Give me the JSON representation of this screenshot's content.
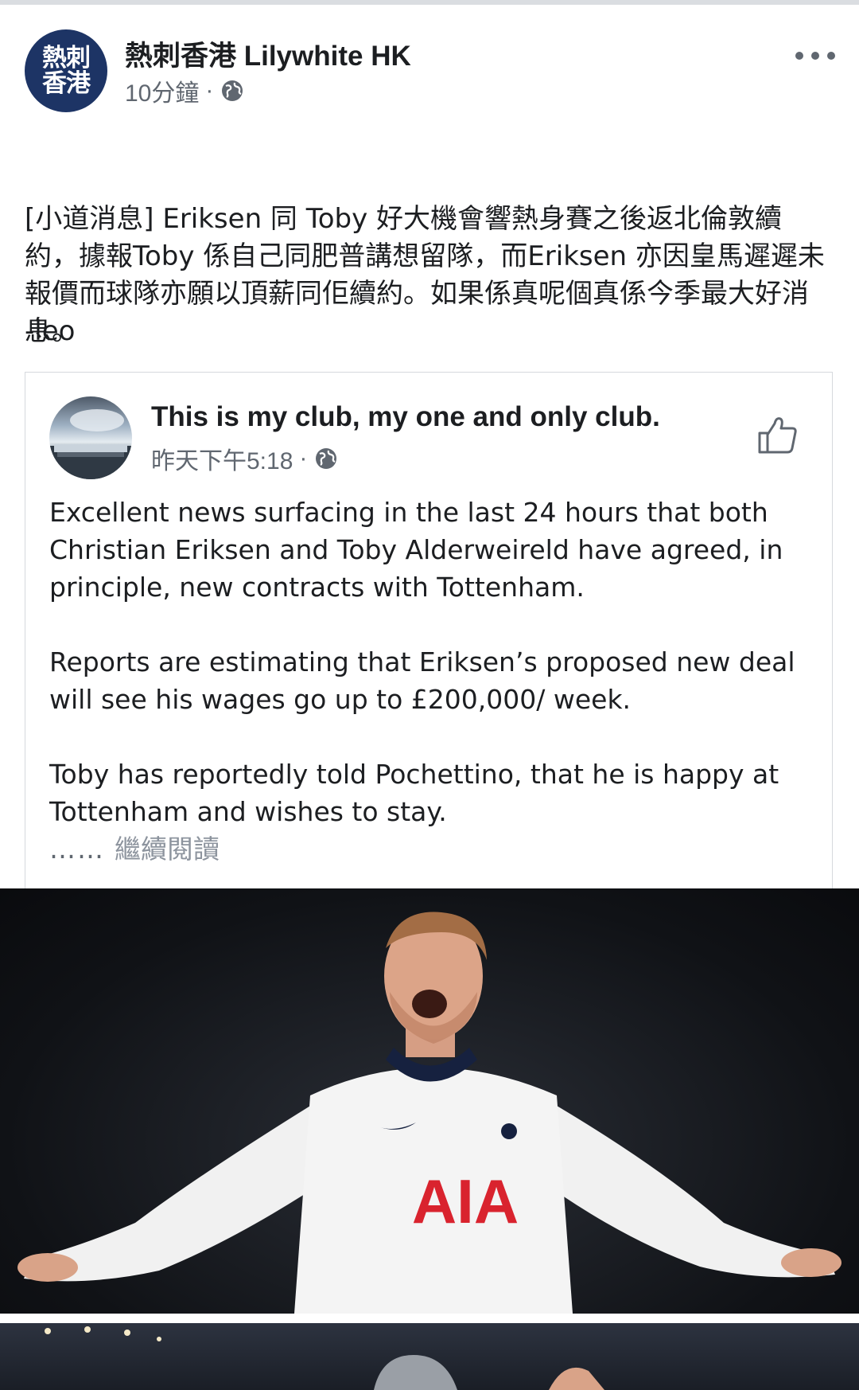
{
  "post": {
    "page_name": "熱刺香港 Lilywhite HK",
    "avatar_line1": "熱刺",
    "avatar_line2": "香港",
    "time": "10分鐘",
    "separator": "·",
    "text": "[小道消息] Eriksen 同 Toby 好大機會響熱身賽之後返北倫敦續約，據報Toby 係自己同肥普講想留隊，而Eriksen 亦因皇馬遲遲未報價而球隊亦願以頂薪同佢續約。如果係真呢個真係今季最大好消息。",
    "signature": "-leo"
  },
  "shared": {
    "title": "This is my club, my one and only club.",
    "time": "昨天下午5:18",
    "separator": "·",
    "paragraphs": [
      "Excellent news surfacing in the last 24 hours that both Christian Eriksen and Toby Alderweireld have agreed, in principle, new contracts with Tottenham.",
      "Reports are estimating that Eriksen’s proposed new deal will see his wages go up to £200,000/ week.",
      "Toby has reportedly told Pochettino, that he is happy at Tottenham and wishes to stay."
    ],
    "ellipsis": "……",
    "see_more": "繼續閱讀"
  },
  "photo": {
    "shirt_sponsor": "AIA"
  },
  "icons": {
    "more": "more-horizontal-icon",
    "globe": "globe-icon",
    "like": "thumbs-up-icon"
  },
  "colors": {
    "avatar_bg": "#1d3465",
    "meta_text": "#606770",
    "see_more": "#8d949e",
    "sponsor_red": "#d9232e"
  }
}
